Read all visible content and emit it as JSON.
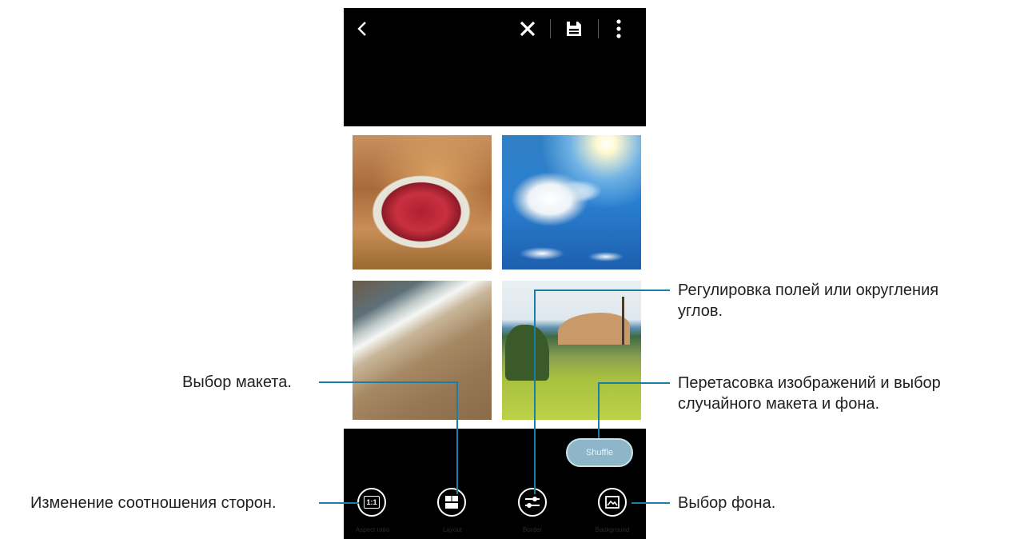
{
  "topbar": {
    "back_icon": "chevron-left-icon",
    "discard_icon": "close-icon",
    "save_icon": "save-icon",
    "more_icon": "more-vertical-icon"
  },
  "shuffle": {
    "label": "Shuffle"
  },
  "toolbar": {
    "aspect_ratio": {
      "glyph": "1:1",
      "label": "Aspect ratio"
    },
    "layout": {
      "label": "Layout"
    },
    "border": {
      "label": "Border"
    },
    "background": {
      "label": "Background"
    }
  },
  "callouts": {
    "border": {
      "line1": "Регулировка полей или округления",
      "line2": "углов."
    },
    "layout": "Выбор макета.",
    "shuffle": {
      "line1": "Перетасовка изображений и выбор",
      "line2": "случайного макета и фона."
    },
    "aspect_ratio": "Изменение соотношения сторон.",
    "background": "Выбор фона."
  },
  "colors": {
    "accent_line": "#1a7ea6",
    "phone_bg": "#000000"
  }
}
